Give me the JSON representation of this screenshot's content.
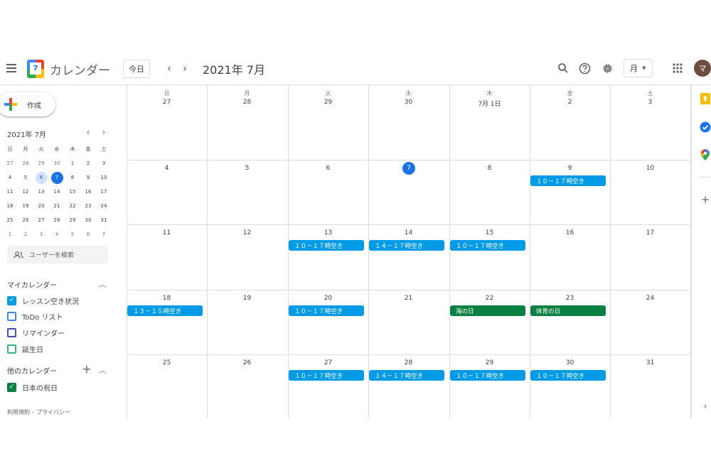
{
  "header": {
    "app_title": "カレンダー",
    "logo_day": "7",
    "today_label": "今日",
    "month_title": "2021年 7月",
    "view_label": "月",
    "avatar_initial": "マ",
    "icons": [
      "menu-icon",
      "chevron-left-icon",
      "chevron-right-icon",
      "search-icon",
      "help-icon",
      "settings-icon",
      "dropdown-caret-icon",
      "apps-grid-icon"
    ]
  },
  "sidebar": {
    "create_label": "作成",
    "mini_title": "2021年 7月",
    "mini_weekdays": [
      "日",
      "月",
      "火",
      "水",
      "木",
      "金",
      "土"
    ],
    "mini_days": [
      [
        "27",
        "28",
        "29",
        "30",
        "1",
        "2",
        "3"
      ],
      [
        "4",
        "5",
        "6",
        "7",
        "8",
        "9",
        "10"
      ],
      [
        "11",
        "12",
        "13",
        "14",
        "15",
        "16",
        "17"
      ],
      [
        "18",
        "19",
        "20",
        "21",
        "22",
        "23",
        "24"
      ],
      [
        "25",
        "26",
        "27",
        "28",
        "29",
        "30",
        "31"
      ],
      [
        "1",
        "2",
        "3",
        "4",
        "5",
        "6",
        "7"
      ]
    ],
    "search_people_placeholder": "ユーザーを検索",
    "my_calendars": {
      "title": "マイカレンダー",
      "items": [
        {
          "label": "レッスン空き状況",
          "checked": true,
          "color": "#039be5"
        },
        {
          "label": "ToDo リスト",
          "checked": false,
          "color": "#4285f4"
        },
        {
          "label": "リマインダー",
          "checked": false,
          "color": "#3f51b5"
        },
        {
          "label": "誕生日",
          "checked": false,
          "color": "#33b679"
        }
      ]
    },
    "other_calendars": {
      "title": "他のカレンダー",
      "items": [
        {
          "label": "日本の祝日",
          "checked": true,
          "color": "#0b8043"
        }
      ]
    },
    "footer": "利用規約 – プライバシー"
  },
  "calendar": {
    "weekdays": [
      "日",
      "月",
      "火",
      "水",
      "木",
      "金",
      "土"
    ],
    "weeks": [
      [
        "27",
        "28",
        "29",
        "30",
        "7月 1日",
        "2",
        "3"
      ],
      [
        "4",
        "5",
        "6",
        "7",
        "8",
        "9",
        "10"
      ],
      [
        "11",
        "12",
        "13",
        "14",
        "15",
        "16",
        "17"
      ],
      [
        "18",
        "19",
        "20",
        "21",
        "22",
        "23",
        "24"
      ],
      [
        "25",
        "26",
        "27",
        "28",
        "29",
        "30",
        "31"
      ]
    ],
    "today": {
      "week": 1,
      "day": 3
    },
    "events": [
      {
        "week": 1,
        "day": 5,
        "title": "１０－１７時空き",
        "color": "#039be5"
      },
      {
        "week": 2,
        "day": 2,
        "title": "１０－１７時空き",
        "color": "#039be5"
      },
      {
        "week": 2,
        "day": 3,
        "title": "１４－１７時空き",
        "color": "#039be5"
      },
      {
        "week": 2,
        "day": 4,
        "title": "１０－１７時空き",
        "color": "#039be5"
      },
      {
        "week": 3,
        "day": 0,
        "title": "１３－１５時空き",
        "color": "#039be5"
      },
      {
        "week": 3,
        "day": 2,
        "title": "１０－１７時空き",
        "color": "#039be5"
      },
      {
        "week": 3,
        "day": 4,
        "title": "海の日",
        "color": "#0b8043"
      },
      {
        "week": 3,
        "day": 5,
        "title": "体育の日",
        "color": "#0b8043"
      },
      {
        "week": 4,
        "day": 2,
        "title": "１０－１７時空き",
        "color": "#039be5"
      },
      {
        "week": 4,
        "day": 3,
        "title": "１４－１７時空き",
        "color": "#039be5"
      },
      {
        "week": 4,
        "day": 4,
        "title": "１０－１７時空き",
        "color": "#039be5"
      },
      {
        "week": 4,
        "day": 5,
        "title": "１０－１７時空き",
        "color": "#039be5"
      }
    ]
  },
  "right_rail": {
    "icons": [
      "keep-icon",
      "tasks-icon",
      "maps-icon",
      "add-addon-icon",
      "expand-panel-icon"
    ]
  },
  "colors": {
    "accent": "#1a73e8",
    "event_blue": "#039be5",
    "holiday_green": "#0b8043",
    "grid_line": "#dadce0"
  }
}
